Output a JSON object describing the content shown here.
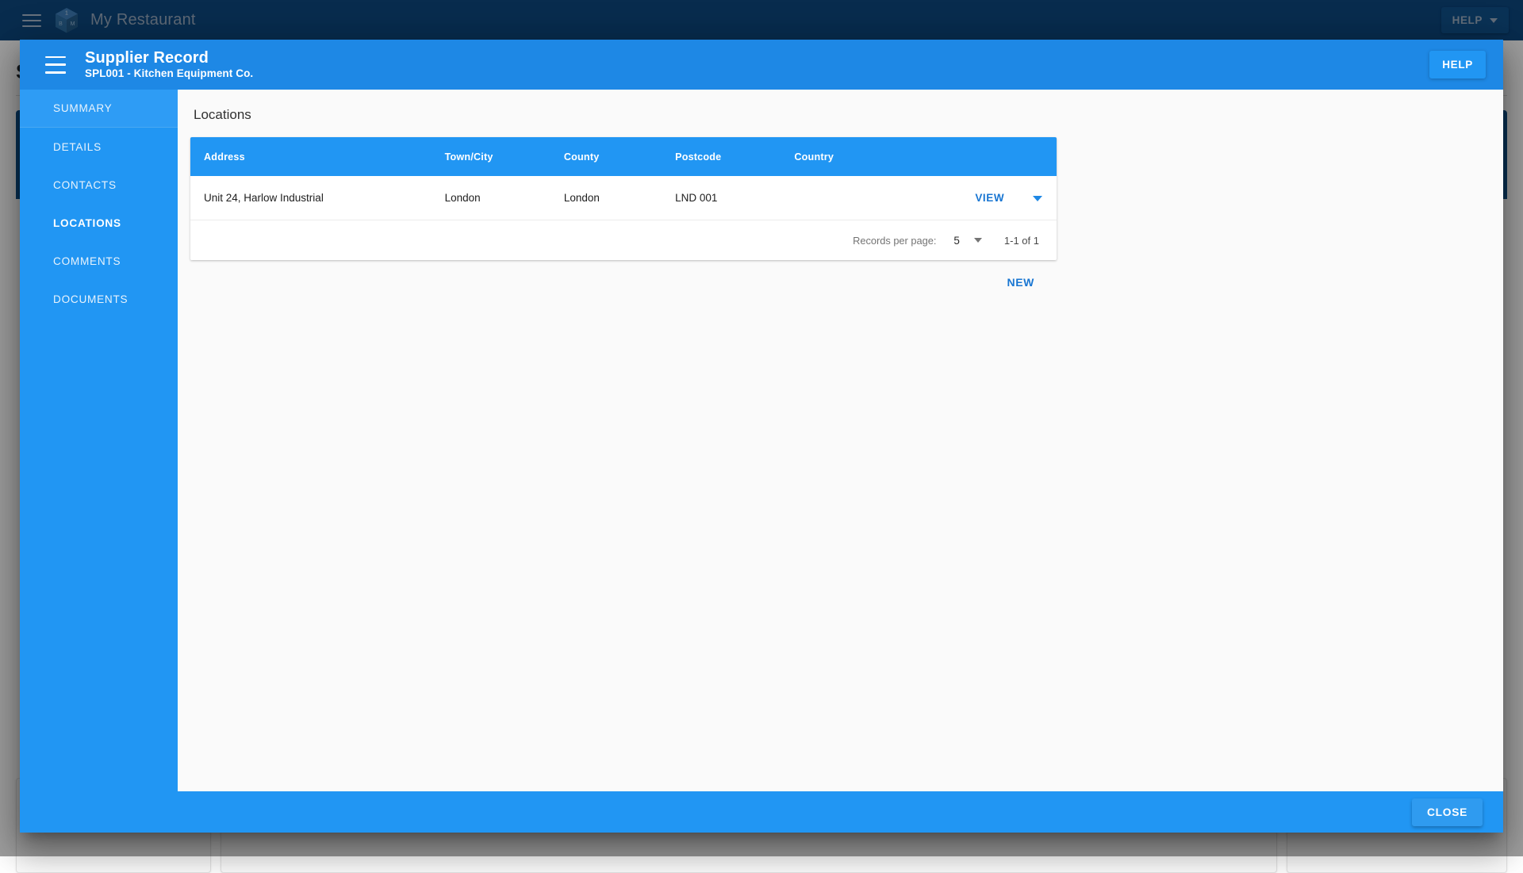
{
  "app": {
    "title": "My Restaurant",
    "logo_icon": "cube-logo-icon",
    "logo_faces": {
      "top": "1",
      "left": "B",
      "right": "M"
    },
    "menu_icon": "hamburger-menu-icon",
    "help_label": "HELP",
    "help_caret_icon": "chevron-down-icon"
  },
  "background_page": {
    "title": "S"
  },
  "dialog": {
    "menu_icon": "hamburger-menu-icon",
    "title": "Supplier Record",
    "subtitle": "SPL001 - Kitchen Equipment Co.",
    "help_label": "HELP",
    "close_label": "CLOSE",
    "sidebar": {
      "items": [
        {
          "label": "SUMMARY",
          "state": "hover"
        },
        {
          "label": "DETAILS",
          "state": "normal"
        },
        {
          "label": "CONTACTS",
          "state": "normal"
        },
        {
          "label": "LOCATIONS",
          "state": "active"
        },
        {
          "label": "COMMENTS",
          "state": "normal"
        },
        {
          "label": "DOCUMENTS",
          "state": "normal"
        }
      ]
    },
    "content": {
      "section_title": "Locations",
      "table": {
        "columns": [
          "Address",
          "Town/City",
          "County",
          "Postcode",
          "Country",
          ""
        ],
        "rows": [
          {
            "address": "Unit 24, Harlow Industrial",
            "town_city": "London",
            "county": "London",
            "postcode": "LND 001",
            "country": "",
            "view_label": "VIEW",
            "caret_icon": "chevron-down-icon"
          }
        ]
      },
      "paginator": {
        "records_per_page_label": "Records per page:",
        "records_per_page_value": "5",
        "caret_icon": "chevron-down-icon",
        "range_label": "1-1 of 1"
      },
      "new_label": "NEW"
    }
  },
  "colors": {
    "app_bar": "#0d477f",
    "dialog_accent": "#1e88e5",
    "sidebar": "#2196f3",
    "table_header": "#2196f3",
    "link": "#1976d2",
    "content_bg": "#fafafa"
  }
}
